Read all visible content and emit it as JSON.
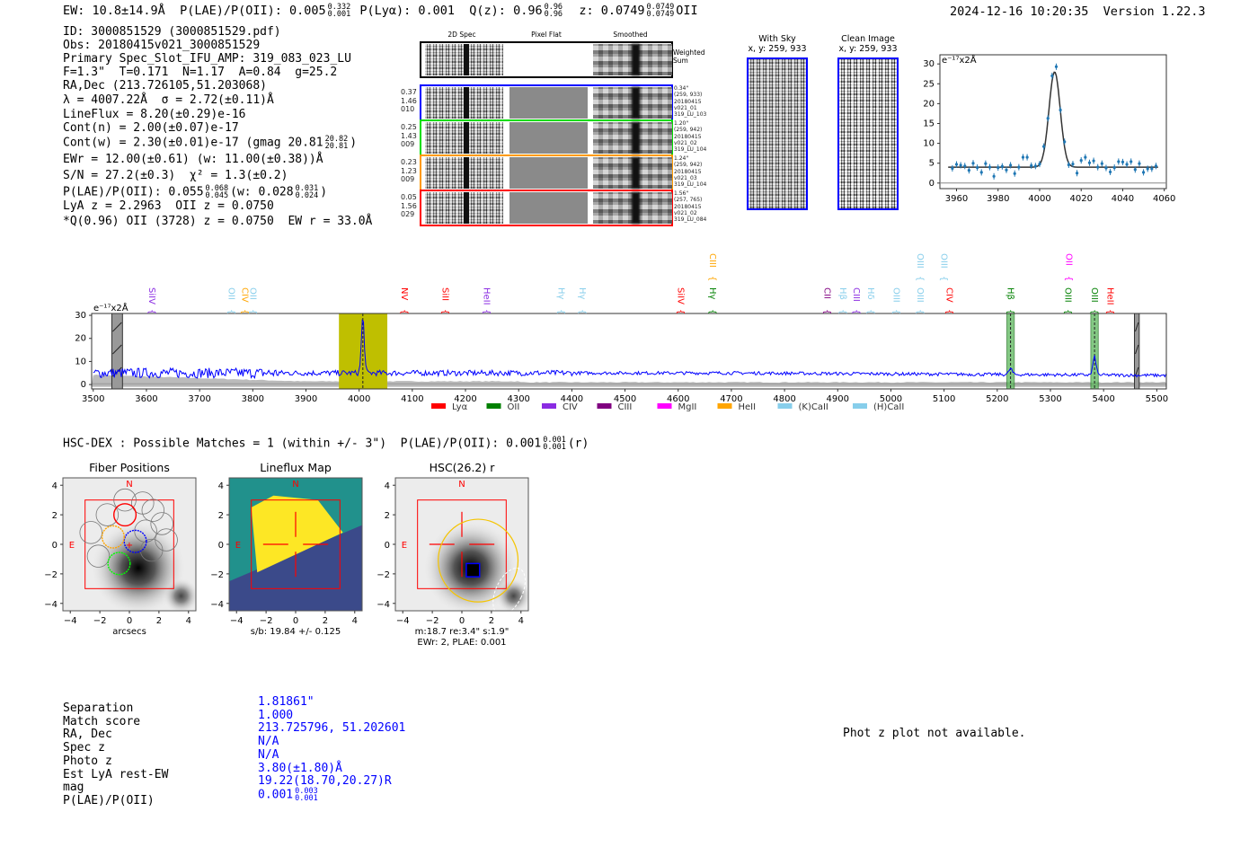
{
  "header": {
    "ew": "EW: 10.8±14.9Å",
    "plae_label": "P(LAE)/P(OII): 0.005",
    "plae_hi": "0.332",
    "plae_lo": "0.001",
    "plya": "P(Lyα): 0.001",
    "qz_label": "Q(z): 0.96",
    "qz_hi": "0.96",
    "qz_lo": "0.96",
    "z_label": "z: 0.0749",
    "z_hi": "0.0749",
    "z_lo": "0.0749",
    "z_line": "OII",
    "timestamp": "2024-12-16 10:20:35  Version 1.22.3"
  },
  "detection": {
    "lines": [
      {
        "text": "ID: 3000851529 (3000851529.pdf)"
      },
      {
        "text": "Obs: 20180415v021_3000851529"
      },
      {
        "text": "Primary Spec_Slot_IFU_AMP: 319_083_023_LU"
      },
      {
        "text": "F=1.3\"  T=0.171  N=1.17  A=0.84  g=25.2"
      },
      {
        "text": "RA,Dec (213.726105,51.203068)"
      },
      {
        "text": "λ = 4007.22Å  σ = 2.72(±0.11)Å"
      },
      {
        "text": "LineFlux = 8.20(±0.29)e-16"
      },
      {
        "text": "Cont(n) = 2.00(±0.07)e-17"
      },
      {
        "text": "Cont(w) = 2.30(±0.01)e-17 (gmag 20.81",
        "hi": "20.82",
        "lo": "20.81",
        "after": ")"
      },
      {
        "text": "EWr = 12.00(±0.61) (w: 11.00(±0.38))Å"
      },
      {
        "text": "S/N = 27.2(±0.3)  χ² = 1.3(±0.2)"
      },
      {
        "text": "P(LAE)/P(OII): 0.055",
        "hi": "0.068",
        "lo": "0.045",
        "after": "(w: 0.028",
        "hi2": "0.031",
        "lo2": "0.024",
        "after2": ")"
      },
      {
        "text": "LyA z = 2.2963  OII z = 0.0750"
      },
      {
        "text": "*Q(0.96) OII (3728) z = 0.0750  EW r = 33.0Å"
      }
    ]
  },
  "fibers2d": {
    "col_headers": [
      "2D Spec",
      "Pixel Flat",
      "Smoothed"
    ],
    "weighted_label": "Weighted\nSum",
    "rows": [
      {
        "color": "#0000ff",
        "left": "0.37\n1.46\n010",
        "right": "0.34\"\n(259, 933)\n20180415\nv021_01\n319_LU_103"
      },
      {
        "color": "#00dd00",
        "left": "0.25\n1.43\n009",
        "right": "1.20\"\n(259, 942)\n20180415\nv021_02\n319_LU_104"
      },
      {
        "color": "#ff9900",
        "left": "0.23\n1.23\n009",
        "right": "1.24\"\n(259, 942)\n20180415\nv021_03\n319_LU_104"
      },
      {
        "color": "#ff0000",
        "left": "0.05\n1.56\n029",
        "right": "1.56\"\n(257, 765)\n20180415\nv021_02\n319_LU_084"
      }
    ]
  },
  "ccd": {
    "with_sky": "With Sky\nx, y: 259, 933",
    "clean": "Clean Image\nx, y: 259, 933"
  },
  "chart_data": [
    {
      "type": "scatter",
      "ylabel": "e⁻¹⁷x2Å",
      "xlim": [
        3952,
        4061
      ],
      "ylim": [
        -1.4,
        32.3
      ],
      "xticks": [
        3960,
        3980,
        4000,
        4020,
        4040,
        4060
      ],
      "yticks": [
        0,
        5,
        10,
        15,
        20,
        25,
        30
      ],
      "points": {
        "x": [
          3958,
          3960,
          3962,
          3964,
          3966,
          3968,
          3970,
          3972,
          3974,
          3976,
          3978,
          3980,
          3982,
          3984,
          3986,
          3988,
          3990,
          3992,
          3994,
          3996,
          3998,
          4000,
          4002,
          4004,
          4006,
          4008,
          4010,
          4012,
          4014,
          4016,
          4018,
          4020,
          4022,
          4024,
          4026,
          4028,
          4030,
          4032,
          4034,
          4036,
          4038,
          4040,
          4042,
          4044,
          4046,
          4048,
          4050,
          4052,
          4054,
          4056
        ],
        "y": [
          3.7,
          4.7,
          4.5,
          4.3,
          3.2,
          5.0,
          3.9,
          2.7,
          4.9,
          4.0,
          1.7,
          3.9,
          4.2,
          3.3,
          4.5,
          2.4,
          4.0,
          6.5,
          6.5,
          4.4,
          4.3,
          4.8,
          9.2,
          16.3,
          27.0,
          29.3,
          18.4,
          10.4,
          4.6,
          4.8,
          2.5,
          5.7,
          6.5,
          5.1,
          5.6,
          4.0,
          4.9,
          3.8,
          2.8,
          3.9,
          5.4,
          5.3,
          4.7,
          5.4,
          3.4,
          4.9,
          2.7,
          3.6,
          3.6,
          4.3
        ],
        "err": 0.8,
        "color": "#1f77b4"
      },
      "model": {
        "type": "gaussian",
        "center": 4007.22,
        "sigma": 2.72,
        "peak_above_continuum": 24.0,
        "continuum": 4.0,
        "color": "#333333"
      }
    },
    {
      "type": "line",
      "ylabel": "e⁻¹⁷x2Å",
      "xlim": [
        3497,
        5518
      ],
      "ylim": [
        -1.9,
        30.8
      ],
      "xticks": [
        3500,
        3600,
        3700,
        3800,
        3900,
        4000,
        4100,
        4200,
        4300,
        4400,
        4500,
        4600,
        4700,
        4800,
        4900,
        5000,
        5100,
        5200,
        5300,
        5400,
        5500
      ],
      "yticks": [
        0,
        10,
        20,
        30
      ],
      "series_color": "#0000ff",
      "continuum_level": 5,
      "emission_peaks": [
        {
          "x": 4007,
          "y": 29
        },
        {
          "x": 5225,
          "y": 7
        },
        {
          "x": 5383,
          "y": 12
        }
      ],
      "highlight_band": {
        "range": [
          3962,
          4053
        ],
        "color": "#bfbf00"
      },
      "masked_bands": [
        [
          3535,
          3555
        ],
        [
          5458,
          5467
        ]
      ],
      "line_bands": [
        [
          5218,
          5232
        ],
        [
          5376,
          5390
        ]
      ],
      "dashed_lines": [
        4007,
        5225,
        5383
      ],
      "line_labels": [
        {
          "name": "SiIV",
          "x": 3610,
          "color": "#8a2be2",
          "tier": 0
        },
        {
          "name": "OII",
          "x": 3760,
          "color": "#87ceeb",
          "tier": 0
        },
        {
          "name": "CIV",
          "x": 3785,
          "color": "#ffa500",
          "tier": 0
        },
        {
          "name": "OII",
          "x": 3800,
          "color": "#87ceeb",
          "tier": 0
        },
        {
          "name": "NV",
          "x": 4085,
          "color": "#ff0000",
          "tier": 0
        },
        {
          "name": "SiII",
          "x": 4162,
          "color": "#ff0000",
          "tier": 0
        },
        {
          "name": "HeII",
          "x": 4240,
          "color": "#8a2be2",
          "tier": 0
        },
        {
          "name": "Hγ",
          "x": 4380,
          "color": "#87ceeb",
          "tier": 0
        },
        {
          "name": "Hγ",
          "x": 4420,
          "color": "#87ceeb",
          "tier": 0
        },
        {
          "name": "SiIV",
          "x": 4605,
          "color": "#ff0000",
          "tier": 0
        },
        {
          "name": "Hγ",
          "x": 4665,
          "color": "#008000",
          "tier": 0
        },
        {
          "name": "CIII",
          "x": 4665,
          "color": "#ffa500",
          "tier": 1
        },
        {
          "name": "CII",
          "x": 4880,
          "color": "#800080",
          "tier": 0
        },
        {
          "name": "Hβ",
          "x": 4910,
          "color": "#87ceeb",
          "tier": 0
        },
        {
          "name": "CIII",
          "x": 4935,
          "color": "#8a2be2",
          "tier": 0
        },
        {
          "name": "Hδ",
          "x": 4962,
          "color": "#87ceeb",
          "tier": 0
        },
        {
          "name": "OIII",
          "x": 5010,
          "color": "#87ceeb",
          "tier": 0
        },
        {
          "name": "OIII",
          "x": 5055,
          "color": "#87ceeb",
          "tier": 0
        },
        {
          "name": "OIII",
          "x": 5055,
          "color": "#87ceeb",
          "tier": 1
        },
        {
          "name": "OIII",
          "x": 5100,
          "color": "#87ceeb",
          "tier": 1
        },
        {
          "name": "CIV",
          "x": 5110,
          "color": "#ff0000",
          "tier": 0
        },
        {
          "name": "Hβ",
          "x": 5225,
          "color": "#008000",
          "tier": 0
        },
        {
          "name": "OIII",
          "x": 5333,
          "color": "#008000",
          "tier": 0
        },
        {
          "name": "OII",
          "x": 5335,
          "color": "#ff00ff",
          "tier": 1
        },
        {
          "name": "OIII",
          "x": 5383,
          "color": "#008000",
          "tier": 0
        },
        {
          "name": "HeII",
          "x": 5412,
          "color": "#ff0000",
          "tier": 0
        }
      ],
      "legend": [
        {
          "name": "Lyα",
          "color": "#ff0000"
        },
        {
          "name": "OII",
          "color": "#008000"
        },
        {
          "name": "CIV",
          "color": "#8a2be2"
        },
        {
          "name": "CIII",
          "color": "#800080"
        },
        {
          "name": "MgII",
          "color": "#ff00ff"
        },
        {
          "name": "HeII",
          "color": "#ffa500"
        },
        {
          "name": "(K)CaII",
          "color": "#87ceeb"
        },
        {
          "name": "(H)CaII",
          "color": "#87ceeb"
        }
      ],
      "legend_placement": "bottom-center"
    }
  ],
  "hsc": {
    "title": "HSC-DEX : Possible Matches = 1 (within +/- 3\")  P(LAE)/P(OII): 0.001",
    "title_hi": "0.001",
    "title_lo": "0.001",
    "title_after": "(r)",
    "ticks": [
      "4",
      "2",
      "0",
      "−2",
      "−4"
    ],
    "xticks": [
      "−4",
      "−2",
      "0",
      "2",
      "4"
    ],
    "north": "N",
    "east": "E",
    "panels": [
      {
        "title": "Fiber Positions",
        "caption": "arcsecs"
      },
      {
        "title": "Lineflux Map",
        "caption": "s/b: 19.84 +/- 0.125"
      },
      {
        "title": "HSC(26.2) r",
        "caption": "m:18.7  re:3.4\"  s:1.9\"\nEWr: 2, PLAE: 0.001"
      }
    ]
  },
  "match": {
    "rows": [
      {
        "label": "Separation",
        "value": "1.81861\""
      },
      {
        "label": "Match score",
        "value": "1.000"
      },
      {
        "label": "RA, Dec",
        "value": "213.725796, 51.202601"
      },
      {
        "label": "Spec z",
        "value": "N/A"
      },
      {
        "label": "Photo z",
        "value": "N/A"
      },
      {
        "label": "Est LyA rest-EW",
        "value": "3.80(±1.80)Å"
      },
      {
        "label": "mag",
        "value": "19.22(18.70,20.27)R"
      },
      {
        "label": "P(LAE)/P(OII)",
        "value": "0.001",
        "hi": "0.003",
        "lo": "0.001"
      }
    ],
    "phot_z_note": "Phot z plot not available."
  }
}
